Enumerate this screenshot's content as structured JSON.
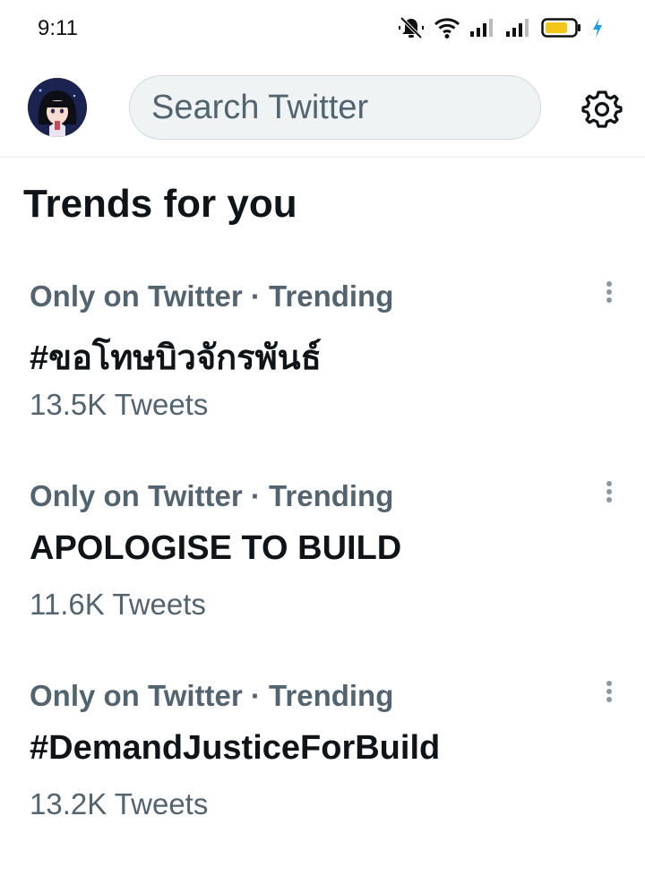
{
  "status_bar": {
    "time": "9:11",
    "icons": [
      "mute-bell-icon",
      "wifi-icon",
      "signal-icon",
      "signal-icon",
      "battery-icon",
      "charging-bolt-icon"
    ],
    "battery_color": "#f5c518",
    "charge_color": "#1d9bf0"
  },
  "header": {
    "search_placeholder": "Search Twitter",
    "settings_icon": "gear-icon",
    "avatar": "user-avatar"
  },
  "section": {
    "title": "Trends for you"
  },
  "trends": [
    {
      "meta": "Only on Twitter · Trending",
      "name": "#ขอโทษบิวจักรพันธ์",
      "count": "13.5K Tweets"
    },
    {
      "meta": "Only on Twitter · Trending",
      "name": "APOLOGISE TO BUILD",
      "count": "11.6K Tweets"
    },
    {
      "meta": "Only on Twitter · Trending",
      "name": "#DemandJusticeForBuild",
      "count": "13.2K Tweets"
    }
  ],
  "colors": {
    "primary_text": "#0f1419",
    "secondary_text": "#536471",
    "search_bg": "#eff3f4",
    "divider": "#e7e9ea"
  }
}
